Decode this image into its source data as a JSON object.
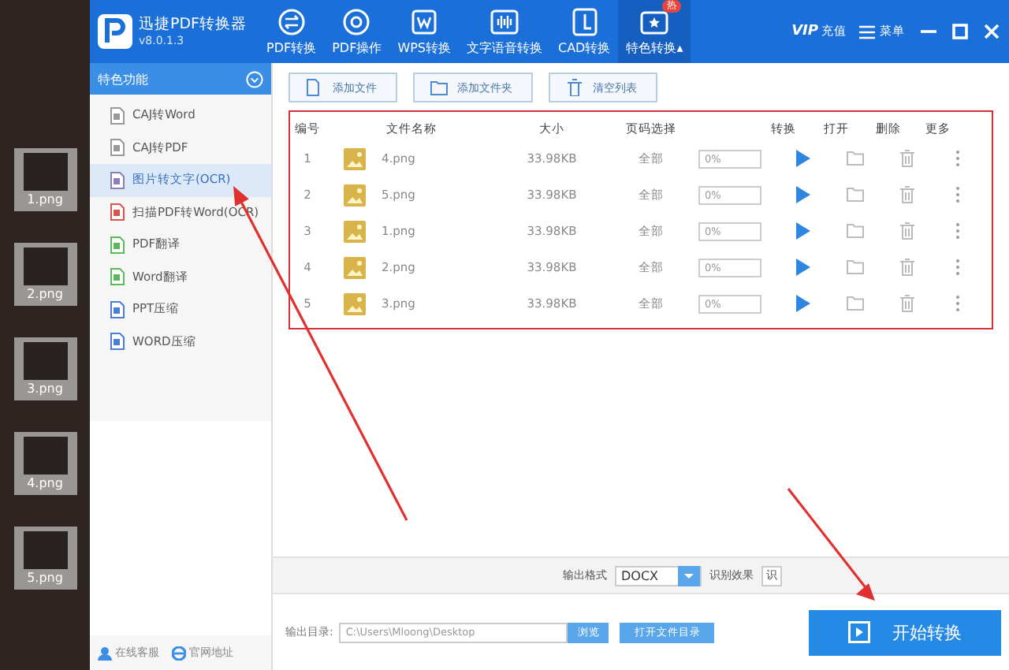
{
  "desktop": {
    "icons": [
      {
        "label": "1.png"
      },
      {
        "label": "2.png"
      },
      {
        "label": "3.png"
      },
      {
        "label": "4.png"
      },
      {
        "label": "5.png"
      }
    ]
  },
  "app": {
    "title": "迅捷PDF转换器",
    "version": "v8.0.1.3"
  },
  "nav": [
    {
      "label": "PDF转换",
      "selected": false
    },
    {
      "label": "PDF操作",
      "selected": false
    },
    {
      "label": "WPS转换",
      "selected": false
    },
    {
      "label": "文字语音转换",
      "selected": false
    },
    {
      "label": "CAD转换",
      "selected": false
    },
    {
      "label": "特色转换▴",
      "selected": true,
      "badge": "热"
    }
  ],
  "header_right": {
    "vip": "VIP",
    "recharge": "充值",
    "menu": "菜单"
  },
  "sidebar": {
    "title": "特色功能",
    "items": [
      {
        "label": "CAJ转Word",
        "selected": false
      },
      {
        "label": "CAJ转PDF",
        "selected": false
      },
      {
        "label": "图片转文字(OCR)",
        "selected": true
      },
      {
        "label": "扫描PDF转Word(OCR)",
        "selected": false
      },
      {
        "label": "PDF翻译",
        "selected": false
      },
      {
        "label": "Word翻译",
        "selected": false
      },
      {
        "label": "PPT压缩",
        "selected": false
      },
      {
        "label": "WORD压缩",
        "selected": false
      }
    ],
    "links": [
      "在线客服",
      "官网地址"
    ]
  },
  "toolbar": [
    "添加文件",
    "添加文件夹",
    "清空列表"
  ],
  "table": {
    "columns": [
      "编号",
      "文件名称",
      "大小",
      "页码选择",
      "转换",
      "打开",
      "删除",
      "更多"
    ],
    "rows": [
      {
        "no": "1",
        "name": "4.png",
        "size": "33.98KB",
        "pages": "全部",
        "progress": "0%",
        "level": 0
      },
      {
        "no": "2",
        "name": "5.png",
        "size": "33.98KB",
        "pages": "全部",
        "progress": "0%",
        "level": 0
      },
      {
        "no": "3",
        "name": "1.png",
        "size": "33.98KB",
        "pages": "全部",
        "progress": "0%",
        "level": 0
      },
      {
        "no": "4",
        "name": "2.png",
        "size": "33.98KB",
        "pages": "全部",
        "progress": "0%",
        "level": 0
      },
      {
        "no": "5",
        "name": "3.png",
        "size": "33.98KB",
        "pages": "全部",
        "progress": "0%",
        "level": 0
      }
    ]
  },
  "format_bar": {
    "label": "输出格式",
    "value": "DOCX",
    "effect_label": "识别效果",
    "effect_value": "识"
  },
  "output": {
    "label": "输出目录:",
    "path": "C:\\Users\\Mloong\\Desktop",
    "browse": "浏览",
    "open": "打开文件目录",
    "start": "开始转换"
  }
}
